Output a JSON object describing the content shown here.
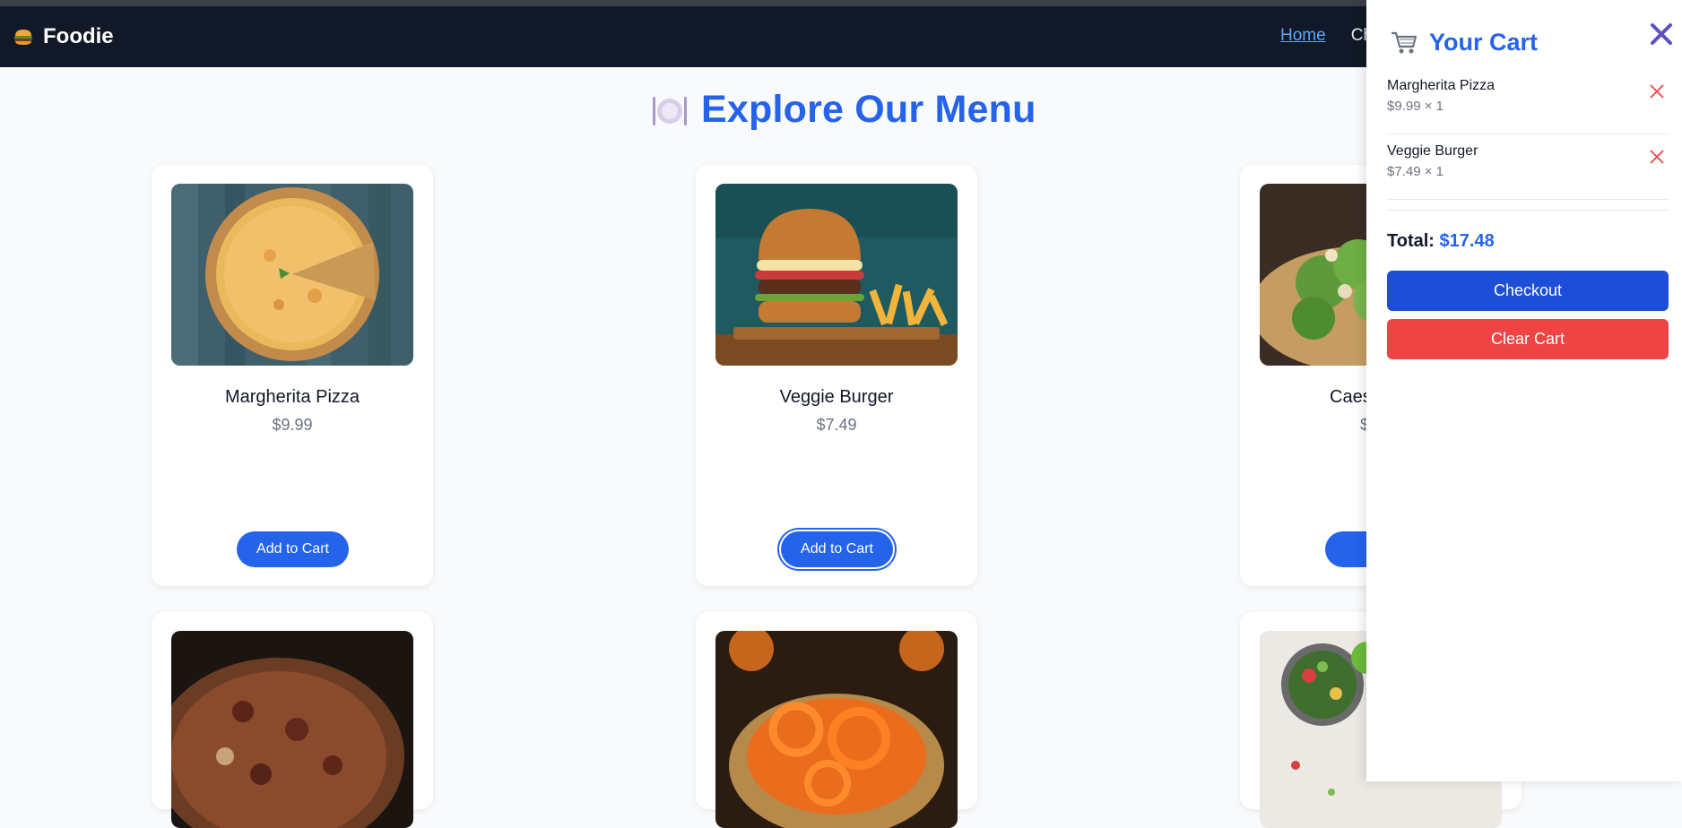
{
  "nav": {
    "brand": "Foodie",
    "links": [
      {
        "label": "Home",
        "active": true
      },
      {
        "label": "Ch"
      }
    ]
  },
  "menu": {
    "title": "Explore Our Menu",
    "items": [
      {
        "name": "Margherita Pizza",
        "price": "$9.99",
        "button": "Add to Cart"
      },
      {
        "name": "Veggie Burger",
        "price": "$7.49",
        "button": "Add to Cart"
      },
      {
        "name": "Caes",
        "price": "$",
        "button": "Add"
      }
    ]
  },
  "cart": {
    "title": "Your Cart",
    "items": [
      {
        "name": "Margherita Pizza",
        "qty_line": "$9.99 × 1"
      },
      {
        "name": "Veggie Burger",
        "qty_line": "$7.49 × 1"
      }
    ],
    "total_label": "Total:",
    "total_value": "$17.48",
    "checkout_label": "Checkout",
    "clear_label": "Clear Cart"
  },
  "colors": {
    "accent": "#2563eb",
    "nav_bg": "#111827",
    "danger": "#ef4444"
  }
}
